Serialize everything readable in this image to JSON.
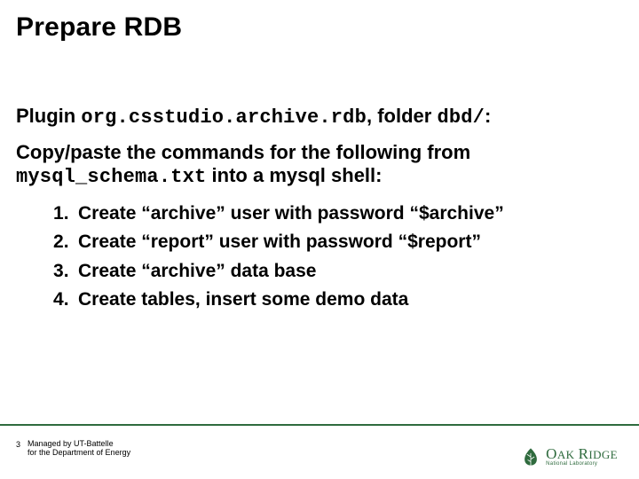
{
  "title": "Prepare RDB",
  "plugin_line": {
    "prefix": "Plugin ",
    "code": "org.csstudio.archive.rdb",
    "after_code": ", folder ",
    "folder": "dbd/",
    "suffix": ":"
  },
  "copy_line": {
    "prefix": "Copy/paste the commands for the following from ",
    "file": "mysql_schema.txt",
    "suffix": " into a mysql shell:"
  },
  "steps": [
    "Create “archive” user with password “$archive”",
    "Create “report” user with password “$report”",
    "Create “archive” data base",
    "Create tables, insert some demo data"
  ],
  "footer": {
    "page": "3",
    "line1": "Managed by UT-Battelle",
    "line2": "for the Department of Energy"
  },
  "logo": {
    "top": "OAK",
    "mid": "RIDGE",
    "bottom": "National Laboratory"
  }
}
